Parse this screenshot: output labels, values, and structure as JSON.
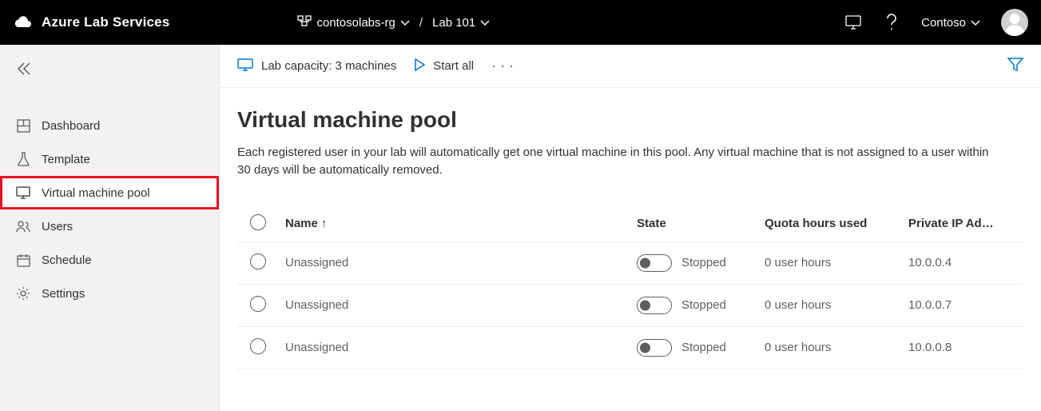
{
  "header": {
    "brand": "Azure Lab Services",
    "resource_group": "contosolabs-rg",
    "lab": "Lab 101",
    "tenant": "Contoso"
  },
  "sidebar": {
    "items": [
      {
        "label": "Dashboard"
      },
      {
        "label": "Template"
      },
      {
        "label": "Virtual machine pool"
      },
      {
        "label": "Users"
      },
      {
        "label": "Schedule"
      },
      {
        "label": "Settings"
      }
    ]
  },
  "toolbar": {
    "capacity_label": "Lab capacity: 3 machines",
    "start_all_label": "Start all"
  },
  "page": {
    "title": "Virtual machine pool",
    "description": "Each registered user in your lab will automatically get one virtual machine in this pool. Any virtual machine that is not assigned to a user within 30 days will be automatically removed."
  },
  "table": {
    "columns": {
      "name": "Name",
      "state": "State",
      "quota": "Quota hours used",
      "ip": "Private IP Ad…"
    },
    "rows": [
      {
        "name": "Unassigned",
        "state": "Stopped",
        "quota": "0 user hours",
        "ip": "10.0.0.4"
      },
      {
        "name": "Unassigned",
        "state": "Stopped",
        "quota": "0 user hours",
        "ip": "10.0.0.7"
      },
      {
        "name": "Unassigned",
        "state": "Stopped",
        "quota": "0 user hours",
        "ip": "10.0.0.8"
      }
    ]
  }
}
